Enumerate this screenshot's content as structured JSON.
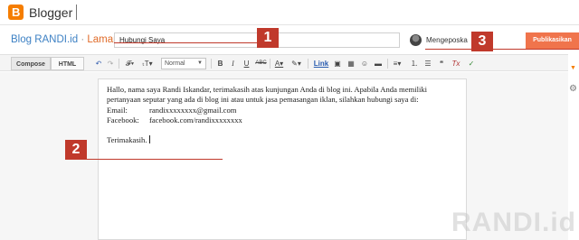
{
  "app": {
    "brand": "Blogger",
    "logo_letter": "B"
  },
  "header": {
    "blog_name": "Blog RANDI.id",
    "separator": "·",
    "section": "Laman",
    "title_value": "Hubungi Saya",
    "author_label": "Mengeposkan",
    "publish_label": "Publikasikan"
  },
  "toolbar": {
    "tabs": {
      "compose": "Compose",
      "html": "HTML"
    },
    "undo": "↶",
    "redo": "↷",
    "font": "𝓕▾",
    "font_size": "ₜT▾",
    "format_value": "Normal",
    "bold": "B",
    "italic": "I",
    "underline": "U",
    "strike": "ABC",
    "text_color": "A▾",
    "highlight": "✎▾",
    "link": "Link",
    "image": "▣",
    "video": "▦",
    "emoji": "☺",
    "jump_break": "▬",
    "align": "≡▾",
    "numbered_list": "⒈",
    "bullet_list": "☰",
    "quote": "❝",
    "clear_format": "Tx",
    "spell": "✓"
  },
  "editor": {
    "paragraph": "Hallo, nama saya Randi Iskandar, terimakasih atas kunjungan Anda di blog ini. Apabila Anda memiliki pertanyaan seputar yang ada di blog ini atau untuk jasa pemasangan iklan, silahkan hubungi saya di:",
    "email_label": "Email:",
    "email_value": "randixxxxxxxx@gmail.com",
    "facebook_label": "Facebook:",
    "facebook_value": "facebook.com/randixxxxxxxx",
    "closing": "Terimakasih."
  },
  "callouts": [
    "1",
    "2",
    "3"
  ],
  "watermark": "RANDI.id",
  "colors": {
    "publish": "#f0744c",
    "callout": "#c0392b",
    "blog_name": "#3d81c4",
    "section": "#e06c2a"
  }
}
